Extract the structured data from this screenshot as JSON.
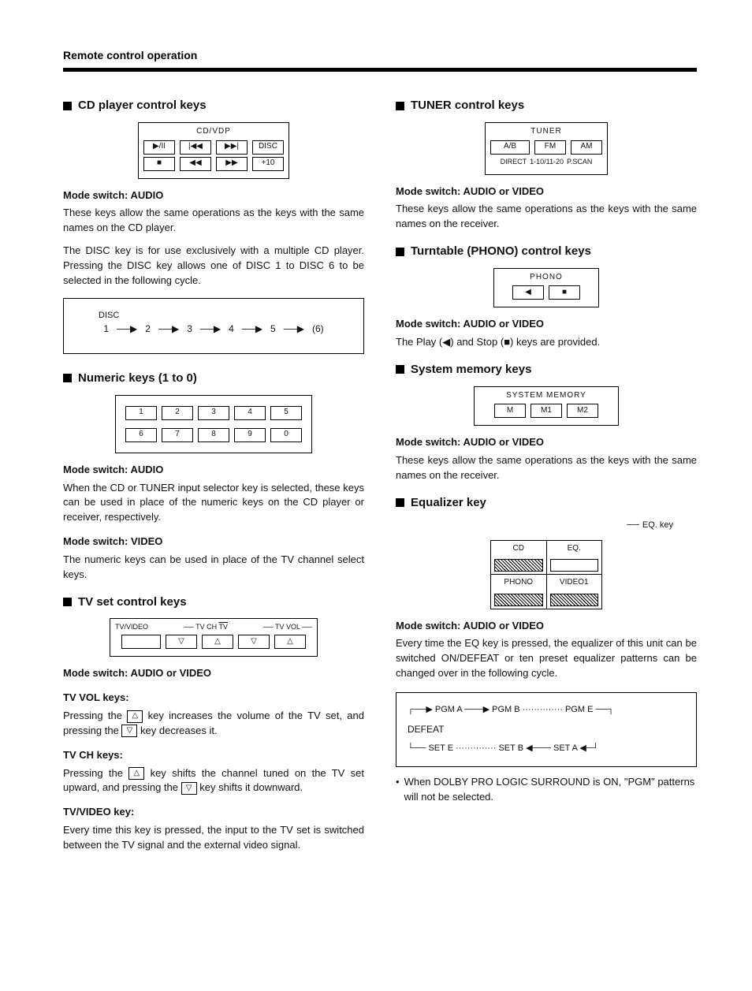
{
  "page_title": "Remote control operation",
  "left": {
    "cd": {
      "heading": "CD player control keys",
      "box_label": "CD/VDP",
      "keys_row1": [
        "▶/II",
        "|◀◀",
        "▶▶|",
        "DISC"
      ],
      "keys_row2": [
        "■",
        "◀◀",
        "▶▶",
        "+10"
      ],
      "sub1": "Mode switch: AUDIO",
      "p1": "These keys allow the same operations as the keys with the same names on the CD player.",
      "p2": "The DISC key is for use exclusively with a multiple CD player. Pressing the DISC key allows one of DISC 1 to DISC 6 to be selected in the following cycle.",
      "cycle_label": "DISC",
      "cycle_items": [
        "1",
        "2",
        "3",
        "4",
        "5",
        "(6)"
      ]
    },
    "numeric": {
      "heading": "Numeric keys (1 to 0)",
      "row1": [
        "1",
        "2",
        "3",
        "4",
        "5"
      ],
      "row2": [
        "6",
        "7",
        "8",
        "9",
        "0"
      ],
      "sub1": "Mode switch: AUDIO",
      "p1": "When the CD or TUNER input selector key is selected, these keys can be used in place of the numeric keys on the CD player or receiver, respectively.",
      "sub2": "Mode switch: VIDEO",
      "p2": "The numeric keys can be used in place of the TV channel select keys."
    },
    "tv": {
      "heading": "TV set control keys",
      "labels": {
        "l": "TV/VIDEO",
        "c": "TV CH",
        "tv": "TV",
        "r": "TV VOL"
      },
      "keys": [
        "",
        "▽",
        "△",
        "▽",
        "△"
      ],
      "sub1": "Mode switch: AUDIO or VIDEO",
      "vol_h": "TV VOL keys:",
      "vol_p_a": "Pressing the ",
      "vol_p_b": " key increases the volume of the TV set, and pressing the ",
      "vol_p_c": " key decreases it.",
      "ch_h": "TV CH keys:",
      "ch_p_a": "Pressing the ",
      "ch_p_b": " key shifts the channel tuned on the TV set upward, and pressing the ",
      "ch_p_c": " key shifts it downward.",
      "tvv_h": "TV/VIDEO key:",
      "tvv_p": "Every time this key is pressed, the input to the TV set is switched between the TV signal and the external video signal."
    }
  },
  "right": {
    "tuner": {
      "heading": "TUNER control keys",
      "box_label": "TUNER",
      "row1": [
        "A/B",
        "FM",
        "AM"
      ],
      "row2": [
        "DIRECT",
        "1-10/11-20",
        "P.SCAN"
      ],
      "sub1": "Mode switch: AUDIO or VIDEO",
      "p1": "These keys allow the same operations as the keys with the same names on the receiver."
    },
    "phono": {
      "heading": "Turntable (PHONO) control keys",
      "box_label": "PHONO",
      "keys": [
        "◀",
        "■"
      ],
      "sub1": "Mode switch: AUDIO or VIDEO",
      "p1_a": "The Play (",
      "p1_b": ") and Stop (",
      "p1_c": ") keys are provided.",
      "play_sym": "◀",
      "stop_sym": "■"
    },
    "sysmem": {
      "heading": "System memory keys",
      "box_label": "SYSTEM MEMORY",
      "keys": [
        "M",
        "M1",
        "M2"
      ],
      "sub1": "Mode switch: AUDIO or VIDEO",
      "p1": "These keys allow the same operations as the keys with the same names on the receiver."
    },
    "eq": {
      "heading": "Equalizer key",
      "callout": "EQ. key",
      "cells": {
        "cd": "CD",
        "eq": "EQ.",
        "phono": "PHONO",
        "video1": "VIDEO1"
      },
      "sub1": "Mode switch: AUDIO or VIDEO",
      "p1": "Every time the EQ key is pressed, the equalizer of this unit can be switched ON/DEFEAT or ten preset equalizer patterns can be changed over in the following cycle.",
      "cycle_top": [
        "PGM A",
        "PGM B",
        "PGM E"
      ],
      "defeat": "DEFEAT",
      "cycle_bot": [
        "SET E",
        "SET B",
        "SET A"
      ],
      "note": "When DOLBY PRO LOGIC SURROUND is ON, \"PGM\" patterns will not be selected."
    }
  }
}
